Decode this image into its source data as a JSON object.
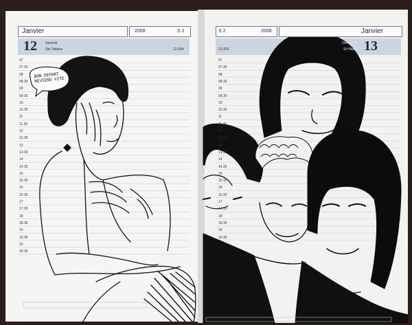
{
  "left_page": {
    "month": "Janvier",
    "year": "2008",
    "week": "S 2",
    "day_number": "12",
    "weekday": "Samedi",
    "saint": "Ste Tatiana",
    "day_of_year": "12-354",
    "hours": [
      "07",
      "07.30",
      "08",
      "08.30",
      "09",
      "09.30",
      "10",
      "10.30",
      "11",
      "11.30",
      "12",
      "12.30",
      "13",
      "13.30",
      "14",
      "14.30",
      "15",
      "15.30",
      "16",
      "16.30",
      "17",
      "17.30",
      "18",
      "18.30",
      "19",
      "19.30",
      "20",
      "20.30"
    ]
  },
  "right_page": {
    "week": "S 2",
    "year": "2008",
    "month": "Janvier",
    "day_number": "13",
    "weekday": "Dimanche",
    "saint": "St Hilaire",
    "day_of_year": "13-353",
    "hours": [
      "07",
      "07.30",
      "08",
      "08.30",
      "09",
      "09.30",
      "10",
      "10.30",
      "11",
      "11.30",
      "12",
      "12.30",
      "13",
      "13.30",
      "14",
      "14.30",
      "15",
      "15.30",
      "16",
      "16.30",
      "17",
      "17.30",
      "18",
      "18.30",
      "19",
      "19.30"
    ]
  },
  "speech_bubble": {
    "line1": "BON DEPART",
    "line2": "REVIENS VITE"
  },
  "colors": {
    "page": "#f4f4f2",
    "header_band": "#c9d2dc",
    "ink": "#111111",
    "rule": "#c8ccd2",
    "cover": "#2c1e1c"
  }
}
